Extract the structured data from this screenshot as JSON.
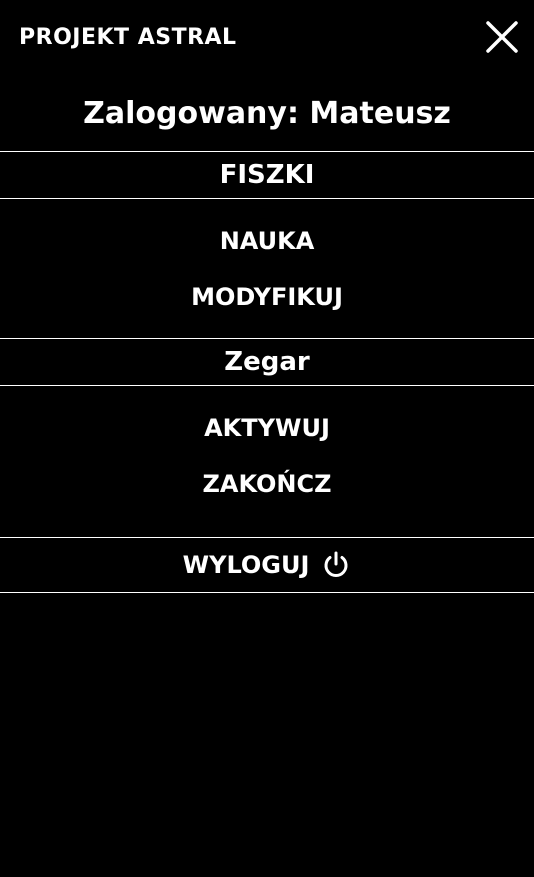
{
  "header": {
    "title": "PROJEKT ASTRAL",
    "close_icon": "close-icon"
  },
  "user": {
    "logged_in_text": "Zalogowany: Mateusz"
  },
  "sections": {
    "flashcards": {
      "title": "FISZKI",
      "items": [
        "NAUKA",
        "MODYFIKUJ"
      ]
    },
    "clock": {
      "title": "Zegar",
      "items": [
        "AKTYWUJ",
        "ZAKOŃCZ"
      ]
    }
  },
  "logout": {
    "label": "WYLOGUJ",
    "icon": "power-icon"
  },
  "colors": {
    "background": "#000000",
    "foreground": "#ffffff"
  }
}
